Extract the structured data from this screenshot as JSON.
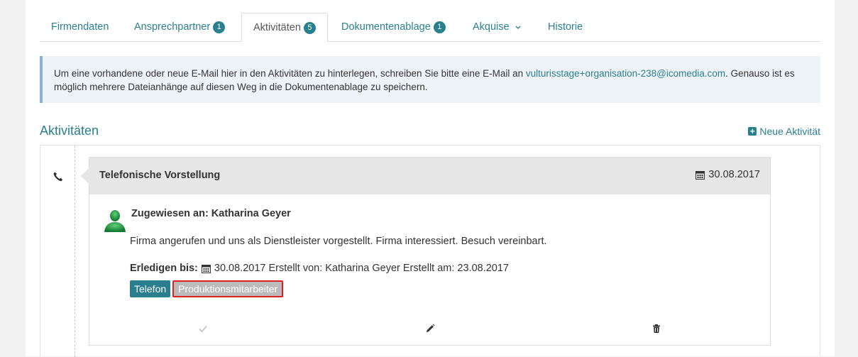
{
  "tabs": [
    {
      "label": "Firmendaten",
      "badge": null
    },
    {
      "label": "Ansprechpartner",
      "badge": "1"
    },
    {
      "label": "Aktivitäten",
      "badge": "5",
      "active": true
    },
    {
      "label": "Dokumentenablage",
      "badge": "1"
    },
    {
      "label": "Akquise",
      "badge": null,
      "dropdown": true
    },
    {
      "label": "Historie",
      "badge": null
    }
  ],
  "info": {
    "text_before": "Um eine vorhandene oder neue E-Mail hier in den Aktivitäten zu hinterlegen, schreiben Sie bitte eine E-Mail an ",
    "email": "vulturisstage+organisation-238@icomedia.com",
    "text_after": ". Genauso ist es möglich mehrere Dateianhänge auf diesen Weg in die Dokumentenablage zu speichern."
  },
  "section": {
    "title": "Aktivitäten",
    "new_label": "Neue Aktivität"
  },
  "activity": {
    "title": "Telefonische Vorstellung",
    "date": "30.08.2017",
    "assigned": "Zugewiesen an: Katharina Geyer",
    "description": "Firma angerufen und uns als Dienstleister vorgestellt. Firma interessiert. Besuch vereinbart.",
    "due_label": "Erledigen bis:",
    "due_rest": "30.08.2017 Erstellt von: Katharina Geyer Erstellt am: 23.08.2017",
    "tags": [
      "Telefon",
      "Produktionsmitarbeiter"
    ]
  },
  "colors": {
    "accent": "#2a7f8f",
    "info_bg": "#eef3f8",
    "info_border": "#86b1dc",
    "highlight": "#e02020"
  },
  "icons": {
    "activity_type": "phone-icon",
    "date": "calendar-icon",
    "avatar": "user-avatar-icon",
    "complete": "check-icon",
    "edit": "pencil-icon",
    "delete": "trash-icon"
  }
}
